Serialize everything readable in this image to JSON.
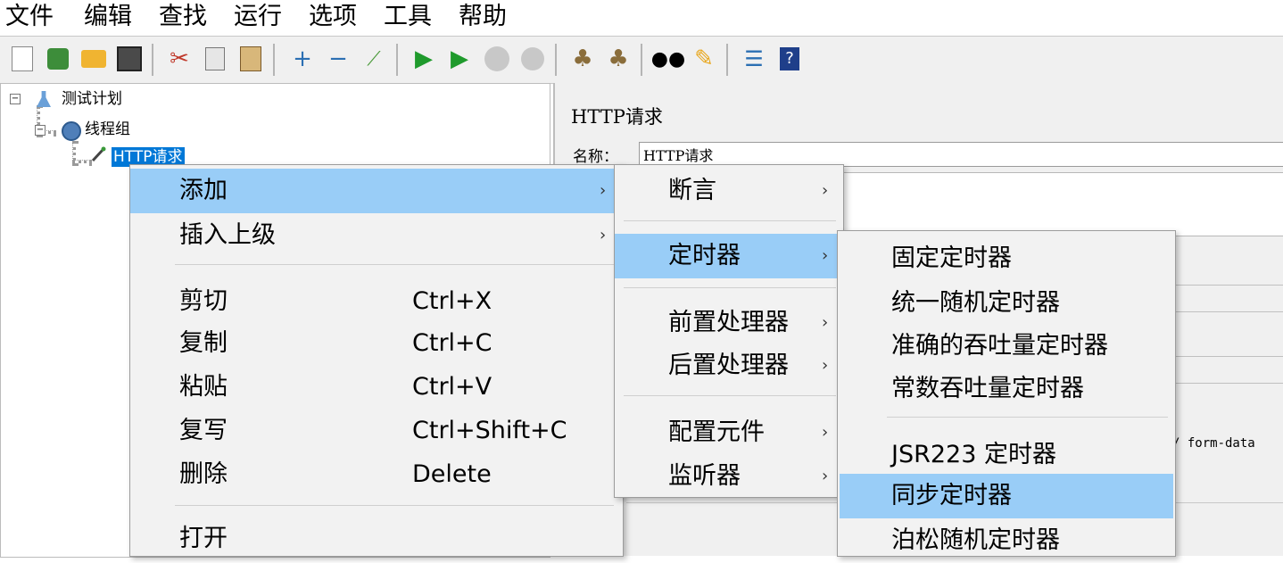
{
  "menubar": {
    "items": [
      "文件",
      "编辑",
      "查找",
      "运行",
      "选项",
      "工具",
      "帮助"
    ]
  },
  "toolbar": {
    "icons": [
      "new-icon",
      "templates-icon",
      "open-icon",
      "save-icon",
      "cut-icon",
      "copy-icon",
      "paste-icon",
      "expand-icon",
      "collapse-icon",
      "toggle-icon",
      "start-icon",
      "start-no-pause-icon",
      "stop-icon",
      "shutdown-icon",
      "clear-icon",
      "clear-all-icon",
      "search-icon",
      "reset-search-icon",
      "function-helper-icon",
      "help-icon"
    ]
  },
  "tree": {
    "test_plan": "测试计划",
    "thread_group": "线程组",
    "http_request": "HTTP请求"
  },
  "panel": {
    "title": "HTTP请求",
    "name_label": "名称：",
    "name_value": "HTTP请求",
    "partial_text": "/ form-data"
  },
  "context_menu": {
    "add": "添加",
    "insert_parent": "插入上级",
    "cut": "剪切",
    "cut_sc": "Ctrl+X",
    "copy": "复制",
    "copy_sc": "Ctrl+C",
    "paste": "粘贴",
    "paste_sc": "Ctrl+V",
    "duplicate": "复写",
    "duplicate_sc": "Ctrl+Shift+C",
    "delete": "删除",
    "delete_sc": "Delete",
    "open": "打开"
  },
  "add_submenu": {
    "assertions": "断言",
    "timer": "定时器",
    "pre_processors": "前置处理器",
    "post_processors": "后置处理器",
    "config_element": "配置元件",
    "listener": "监听器"
  },
  "timer_submenu": {
    "constant_timer": "固定定时器",
    "uniform_random_timer": "统一随机定时器",
    "precise_throughput_timer": "准确的吞吐量定时器",
    "constant_throughput_timer": "常数吞吐量定时器",
    "jsr223_timer": "JSR223 定时器",
    "sync_timer": "同步定时器",
    "poisson_random_timer": "泊松随机定时器"
  },
  "colors": {
    "highlight": "#99cdf7",
    "selected_node": "#0078d7"
  }
}
